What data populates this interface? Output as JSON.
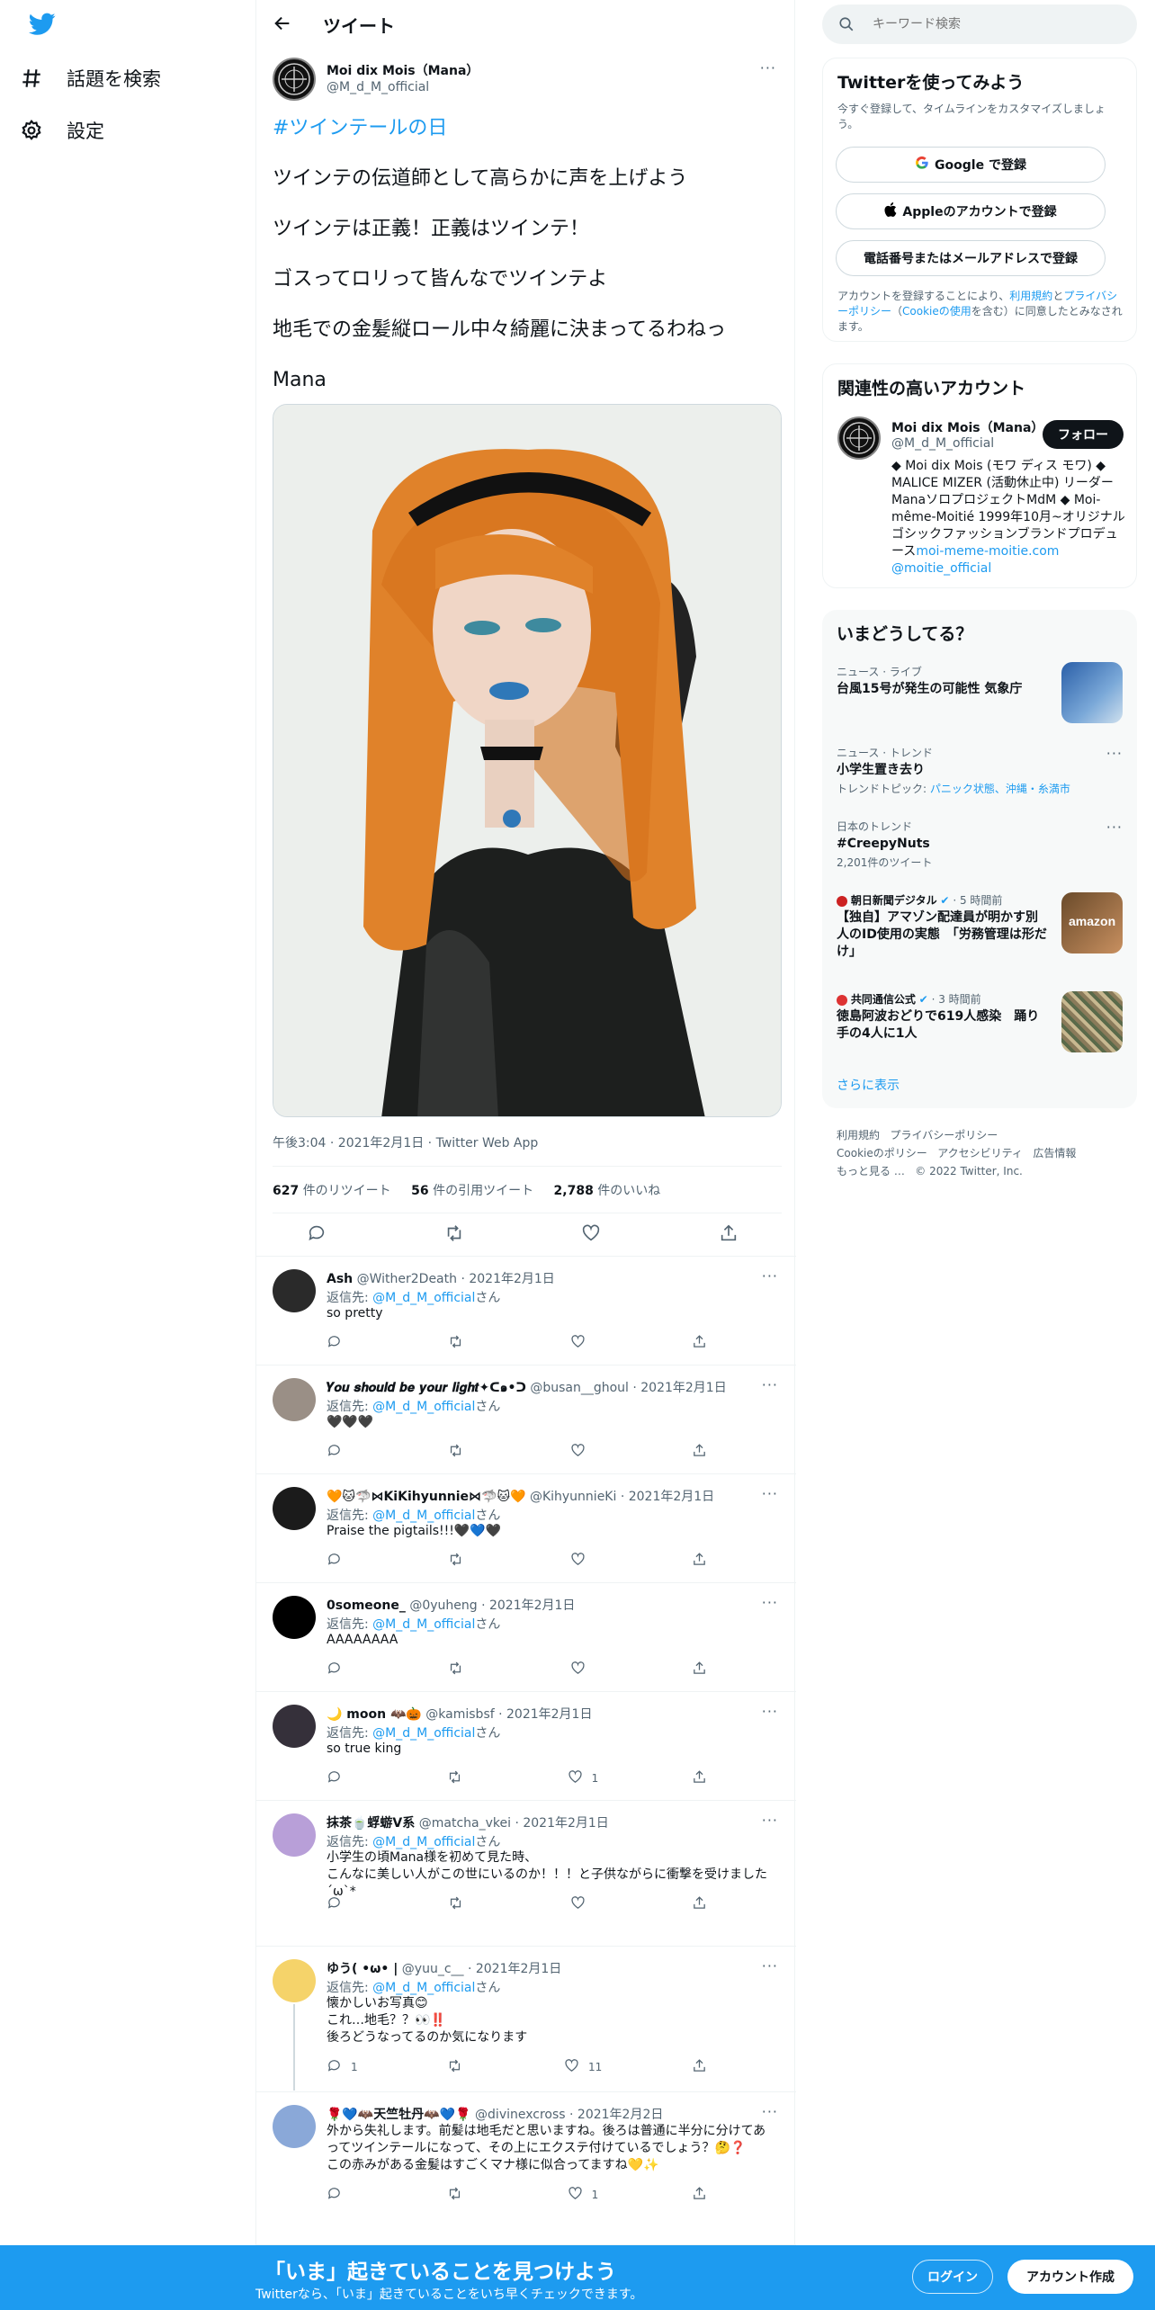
{
  "nav": {
    "explore_label": "話題を検索",
    "settings_label": "設定"
  },
  "header": {
    "title": "ツイート"
  },
  "tweet": {
    "author_name": "Moi dix Mois（Mana）",
    "author_handle": "@M_d_M_official",
    "hashtag": "#ツインテールの日",
    "lines": [
      "ツインテの伝道師として高らかに声を上げよう",
      "ツインテは正義！正義はツインテ！",
      "ゴスってロリって皆んなでツインテよ",
      "地毛での金髪縦ロール中々綺麗に決まってるわねっ",
      "Mana"
    ],
    "timestamp": "午後3:04 · 2021年2月1日 · Twitter Web App",
    "retweets_count": "627",
    "retweets_label": "件のリツイート",
    "quotes_count": "56",
    "quotes_label": "件の引用ツイート",
    "likes_count": "2,788",
    "likes_label": "件のいいね"
  },
  "replies": [
    {
      "name": "Ash",
      "handle": "@Wither2Death",
      "date": "· 2021年2月1日",
      "to_prefix": "返信先: ",
      "to_handle": "@M_d_M_official",
      "to_suffix": "さん",
      "text": "so pretty",
      "reply_count": "",
      "retweet_count": "",
      "like_count": ""
    },
    {
      "name": "𝒀𝒐𝒖 𝒔𝒉𝒐𝒖𝒍𝒅 𝒃𝒆 𝒚𝒐𝒖𝒓 𝒍𝒊𝒈𝒉𝒕✦ᑕ๑•ᑐ",
      "handle": "@busan__ghoul",
      "date": "· 2021年2月1日",
      "to_prefix": "返信先: ",
      "to_handle": "@M_d_M_official",
      "to_suffix": "さん",
      "text": "🖤🖤🖤",
      "reply_count": "",
      "retweet_count": "",
      "like_count": ""
    },
    {
      "name": "🧡🐱🦈⋈KiKihyunnie⋈🦈🐱🧡",
      "handle": "@KihyunnieKi",
      "date": "· 2021年2月1日",
      "to_prefix": "返信先: ",
      "to_handle": "@M_d_M_official",
      "to_suffix": "さん",
      "text": "Praise the pigtails!!!🖤💙🖤",
      "reply_count": "",
      "retweet_count": "",
      "like_count": ""
    },
    {
      "name": "0someone_",
      "handle": "@0yuheng",
      "date": "· 2021年2月1日",
      "to_prefix": "返信先: ",
      "to_handle": "@M_d_M_official",
      "to_suffix": "さん",
      "text": "AAAAAAAA",
      "reply_count": "",
      "retweet_count": "",
      "like_count": ""
    },
    {
      "name": "🌙 moon 🦇🎃",
      "handle": "@kamisbsf",
      "date": "· 2021年2月1日",
      "to_prefix": "返信先: ",
      "to_handle": "@M_d_M_official",
      "to_suffix": "さん",
      "text": "so true king",
      "reply_count": "",
      "retweet_count": "",
      "like_count": "1"
    },
    {
      "name": "抹茶🍵蜉蝣V系",
      "handle": "@matcha_vkei",
      "date": "· 2021年2月1日",
      "to_prefix": "返信先: ",
      "to_handle": "@M_d_M_official",
      "to_suffix": "さん",
      "text": "小学生の頃Mana様を初めて見た時、\nこんなに美しい人がこの世にいるのか！！！と子供ながらに衝撃を受けました´ω`*",
      "reply_count": "",
      "retweet_count": "",
      "like_count": ""
    },
    {
      "name": "ゆう( •ω• |",
      "handle": "@yuu_c__",
      "date": "· 2021年2月1日",
      "to_prefix": "返信先: ",
      "to_handle": "@M_d_M_official",
      "to_suffix": "さん",
      "text": "懐かしいお写真😊\nこれ…地毛？？👀‼️\n後ろどうなってるのか気になります",
      "reply_count": "1",
      "retweet_count": "",
      "like_count": "11"
    },
    {
      "name": "🌹💙🦇天竺牡丹🦇💙🌹",
      "handle": "@divinexcross",
      "date": "· 2021年2月2日",
      "to_prefix": "",
      "to_handle": "",
      "to_suffix": "",
      "text": "外から失礼します。前髪は地毛だと思いますね。後ろは普通に半分に分けてあってツインテールになって、その上にエクステ付けているでしょう？🤔❓\nこの赤みがある金髪はすごくマナ様に似合ってますね💛✨",
      "reply_count": "",
      "retweet_count": "",
      "like_count": "1"
    }
  ],
  "search": {
    "placeholder": "キーワード検索"
  },
  "signup": {
    "title": "Twitterを使ってみよう",
    "subtitle": "今すぐ登録して、タイムラインをカスタマイズしましょう。",
    "google_label": "Google で登録",
    "apple_label": "Appleのアカウントで登録",
    "phone_label": "電話番号またはメールアドレスで登録",
    "legal_prefix": "アカウントを登録することにより、",
    "legal_terms": "利用規約",
    "legal_and": "と",
    "legal_privacy": "プライバシーポリシー",
    "legal_paren_open": "（",
    "legal_cookie": "Cookieの使用",
    "legal_suffix": "を含む）に同意したとみなされます。"
  },
  "related": {
    "title": "関連性の高いアカウント",
    "name": "Moi dix Mois（Mana）",
    "handle": "@M_d_M_official",
    "follow_label": "フォロー",
    "bio": "◆ Moi dix Mois (モワ ディス モワ) ◆ MALICE MIZER (活動休止中) リーダーManaソロプロジェクトMdM ◆ Moi-même-Moitié 1999年10月~オリジナルゴシックファッションブランドプロデュース",
    "bio_link": "moi-meme-moitie.com",
    "bio_mention": "@moitie_official"
  },
  "trends": {
    "title": "いまどうしてる？",
    "items": [
      {
        "category": "ニュース · ライブ",
        "title": "台風15号が発生の可能性 気象庁",
        "sub": ""
      },
      {
        "category": "ニュース · トレンド",
        "title": "小学生置き去り",
        "sub_prefix": "トレンドトピック: ",
        "sub": "パニック状態、沖縄・糸満市"
      },
      {
        "category": "日本のトレンド",
        "title": "#CreepyNuts",
        "sub": "2,201件のツイート"
      },
      {
        "source": "朝日新聞デジタル",
        "time": "· 5 時間前",
        "title": "【独自】アマゾン配達員が明かす別人のID使用の実態　「労務管理は形だけ」"
      },
      {
        "source": "共同通信公式",
        "time": "· 3 時間前",
        "title": "徳島阿波おどりで619人感染　踊り手の4人に1人"
      }
    ],
    "show_more": "さらに表示"
  },
  "footer": {
    "links": [
      "利用規約",
      "プライバシーポリシー",
      "Cookieのポリシー",
      "アクセシビリティ",
      "広告情報",
      "もっと見る …",
      "© 2022 Twitter, Inc."
    ]
  },
  "bottombar": {
    "title": "「いま」起きていることを見つけよう",
    "subtitle": "Twitterなら、「いま」起きていることをいち早くチェックできます。",
    "login_label": "ログイン",
    "signup_label": "アカウント作成"
  },
  "colors": {
    "accent": "#1d9bf0",
    "text": "#0f1419",
    "muted": "#536471",
    "border": "#eff3f4"
  }
}
